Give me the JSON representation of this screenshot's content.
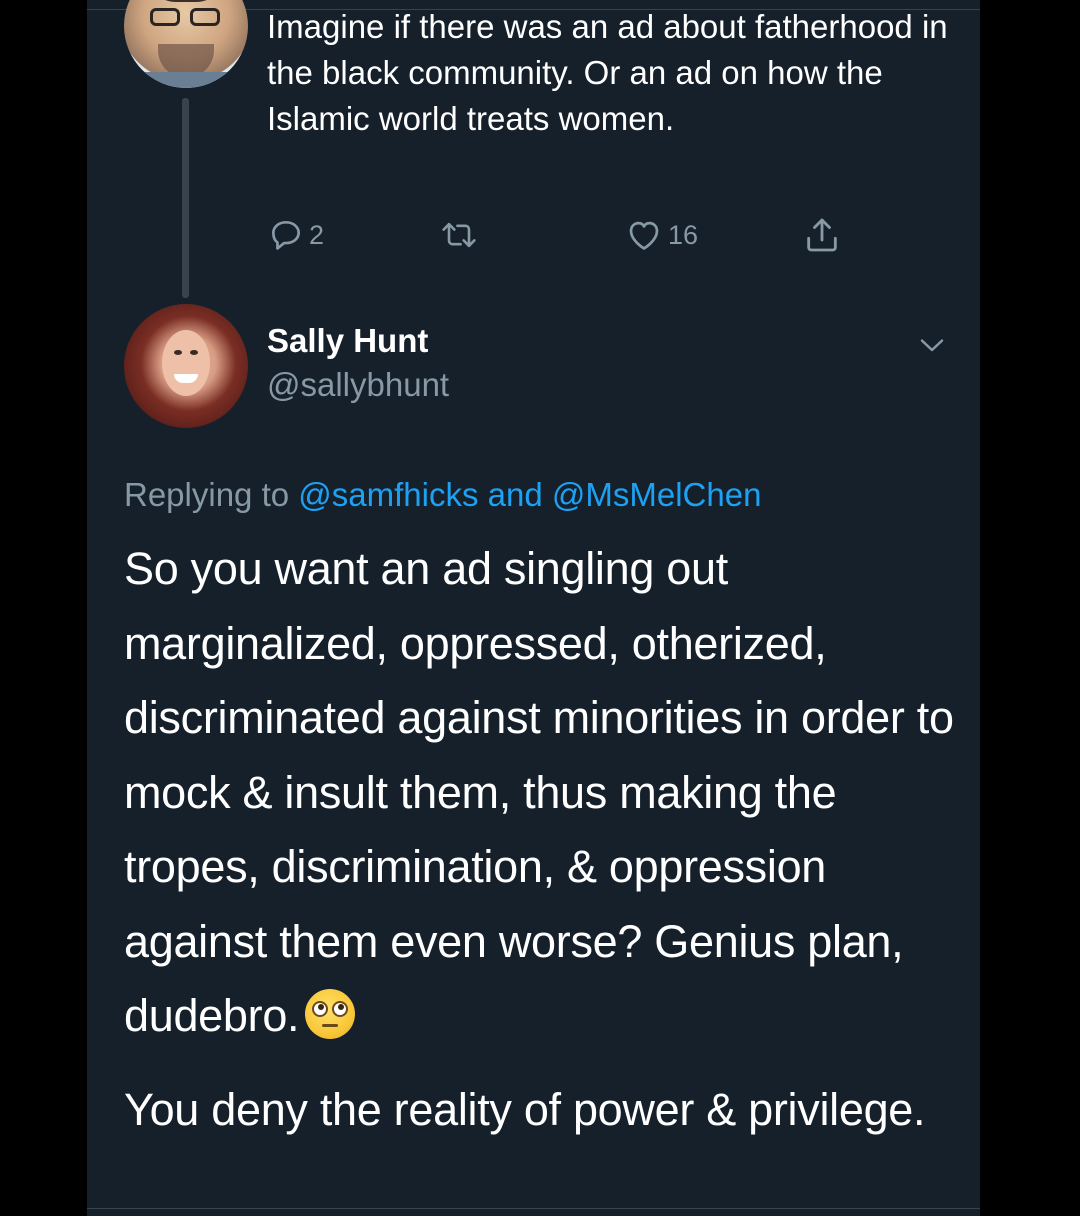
{
  "parent_tweet": {
    "avatar": "profile-photo-man-with-glasses",
    "text": "Imagine if there was an ad about fatherhood in the black community. Or an ad on how the Islamic world treats women.",
    "actions": {
      "reply_icon": "reply-icon",
      "reply_count": "2",
      "retweet_icon": "retweet-icon",
      "retweet_count": "",
      "like_icon": "heart-icon",
      "like_count": "16",
      "share_icon": "share-icon"
    }
  },
  "main_tweet": {
    "avatar": "profile-photo-woman-red-hair",
    "display_name": "Sally Hunt",
    "handle": "@sallybhunt",
    "menu_icon": "chevron-down-icon",
    "replying_prefix": "Replying to",
    "replying_mentions": "@samfhicks and @MsMelChen",
    "body_paragraph_1": "So you want an ad singling out marginalized, oppressed, otherized, discriminated against minorities in order to mock & insult them, thus making the tropes, discrimination, & oppression against them even worse? Genius plan, dudebro.",
    "body_emoji": "face-with-rolling-eyes",
    "body_paragraph_2": "You deny the reality of power & privilege."
  },
  "colors": {
    "background": "#15202b",
    "outer": "#000000",
    "text_primary": "#ffffff",
    "text_secondary": "#8899a6",
    "link": "#1da1f2",
    "divider": "#38444d"
  }
}
